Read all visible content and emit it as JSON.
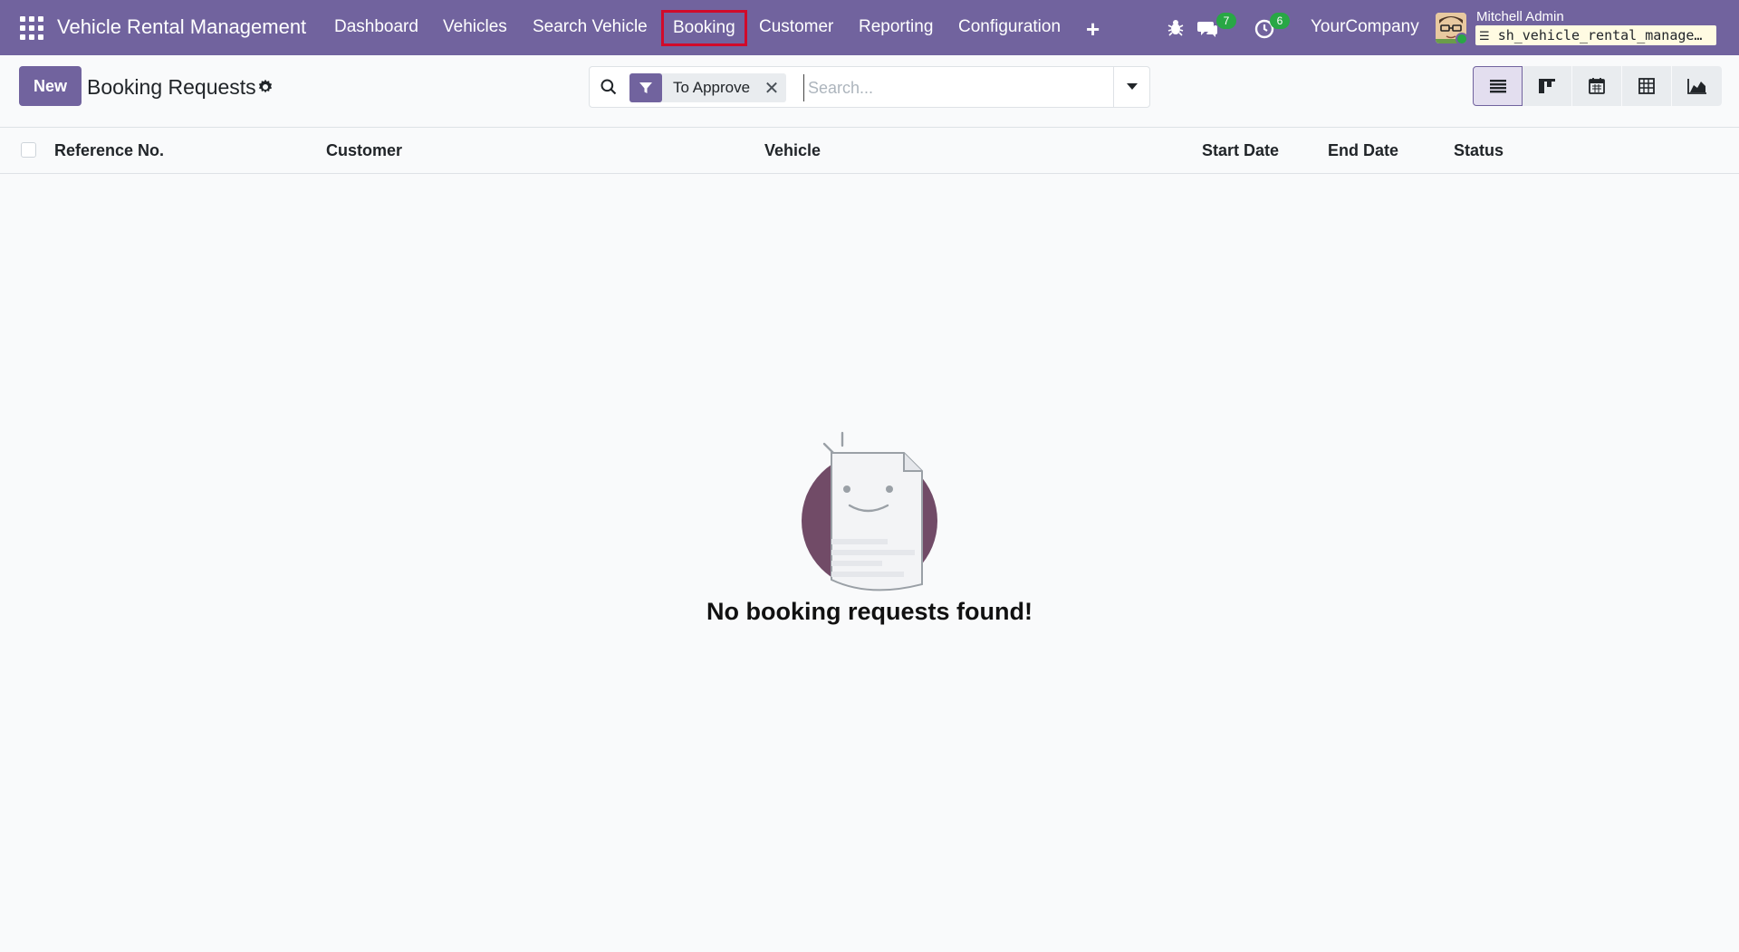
{
  "navbar": {
    "brand": "Vehicle Rental Management",
    "menu": [
      {
        "label": "Dashboard",
        "highlight": false
      },
      {
        "label": "Vehicles",
        "highlight": false
      },
      {
        "label": "Search Vehicle",
        "highlight": false
      },
      {
        "label": "Booking",
        "highlight": true
      },
      {
        "label": "Customer",
        "highlight": false
      },
      {
        "label": "Reporting",
        "highlight": false
      },
      {
        "label": "Configuration",
        "highlight": false
      }
    ],
    "messages_count": "7",
    "activities_count": "6",
    "company": "YourCompany",
    "user_name": "Mitchell Admin",
    "database": "sh_vehicle_rental_manage…"
  },
  "control_panel": {
    "new_label": "New",
    "title": "Booking Requests",
    "search": {
      "facet_label": "To Approve",
      "placeholder": "Search..."
    },
    "views": [
      "list",
      "kanban",
      "calendar",
      "pivot",
      "graph"
    ]
  },
  "table": {
    "columns": [
      "Reference No.",
      "Customer",
      "Vehicle",
      "Start Date",
      "End Date",
      "Status"
    ]
  },
  "empty_state": {
    "message": "No booking requests found!"
  },
  "colors": {
    "brand": "#71639e",
    "highlight_outline": "#d10a2a",
    "badge": "#28a745"
  }
}
